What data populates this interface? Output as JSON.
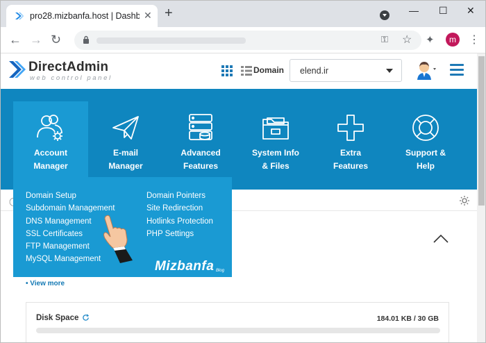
{
  "browser": {
    "tab_title": "pro28.mizbanfa.host | Dashboard",
    "close_glyph": "✕",
    "new_tab_glyph": "+",
    "minimize_glyph": "—",
    "maximize_glyph": "☐",
    "window_close_glyph": "✕",
    "back_glyph": "←",
    "forward_glyph": "→",
    "reload_glyph": "↻",
    "profile_initial": "m",
    "accent": "#c2185b"
  },
  "header": {
    "logo_title": "DirectAdmin",
    "logo_subtitle": "web control panel",
    "domain_label": "Domain",
    "domain_value": "elend.ir"
  },
  "nav": {
    "items": [
      {
        "label": "Account\nManager",
        "icon": "account-manager-icon"
      },
      {
        "label": "E-mail\nManager",
        "icon": "paper-plane-icon"
      },
      {
        "label": "Advanced\nFeatures",
        "icon": "server-database-icon"
      },
      {
        "label": "System Info\n& Files",
        "icon": "folder-icon"
      },
      {
        "label": "Extra\nFeatures",
        "icon": "plus-icon"
      },
      {
        "label": "Support &\nHelp",
        "icon": "lifebuoy-icon"
      }
    ],
    "bar_color": "#0f86bf",
    "active_color": "#1a9ad3"
  },
  "submenu": {
    "left": [
      "Domain Setup",
      "Subdomain Management",
      "DNS Management",
      "SSL Certificates",
      "FTP Management",
      "MySQL Management"
    ],
    "right": [
      "Domain Pointers",
      "Site Redirection",
      "Hotlinks Protection",
      "PHP Settings"
    ],
    "brand": "Mizbanfa",
    "brand_sub": "Blog"
  },
  "main": {
    "view_more": "• View more",
    "disk_label": "Disk Space",
    "disk_value": "184.01 KB / 30 GB",
    "disk_fraction": 0.0
  }
}
